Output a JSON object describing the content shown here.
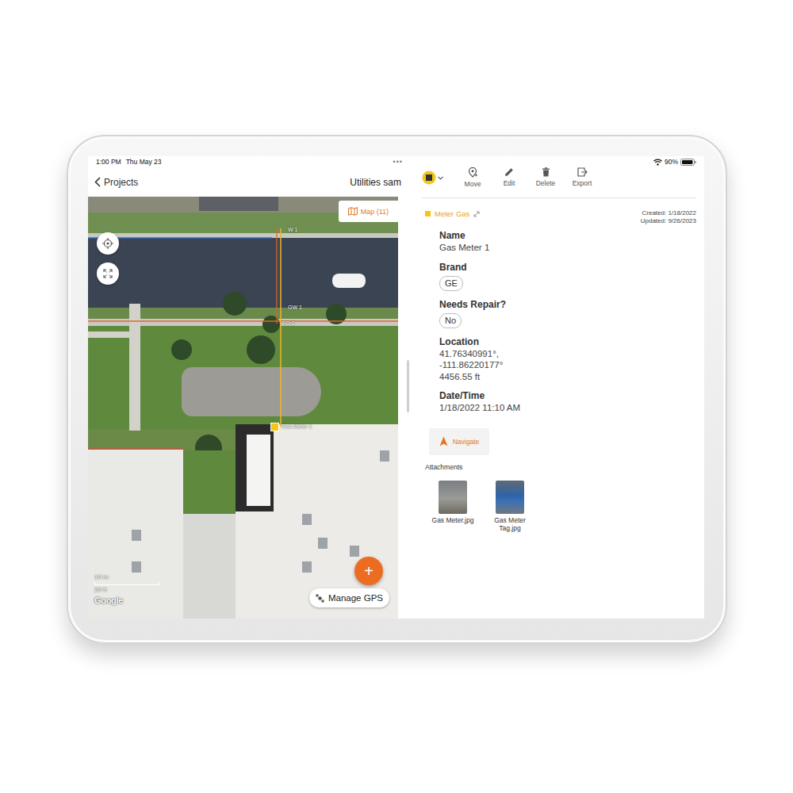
{
  "status_bar": {
    "time": "1:00 PM",
    "date": "Thu May 23",
    "more": "•••",
    "battery": "90%"
  },
  "map_pane": {
    "back": "Projects",
    "title": "Utilities sam",
    "map_button": "Map (11)",
    "line_labels": [
      {
        "text": "W 1"
      },
      {
        "text": "GW 1"
      },
      {
        "text": "FO 1"
      }
    ],
    "marker": {
      "label": "Gas Meter 1",
      "color": "#f5c518",
      "selected": true
    },
    "scale": {
      "metric": "10 m",
      "imperial": "20 ft"
    },
    "attribution": "Google",
    "manage_gps": "Manage GPS",
    "add": "+"
  },
  "toolbar": {
    "actions": [
      {
        "label": "Move"
      },
      {
        "label": "Edit"
      },
      {
        "label": "Delete"
      },
      {
        "label": "Export"
      }
    ]
  },
  "record": {
    "layer": "Meter Gas",
    "layer_color": "#f5c518",
    "created": "Created: 1/18/2022",
    "updated": "Updated: 9/26/2023",
    "fields": [
      {
        "label": "Name",
        "kind": "text",
        "values": [
          "Gas Meter 1"
        ]
      },
      {
        "label": "Brand",
        "kind": "chip",
        "values": [
          "GE"
        ]
      },
      {
        "label": "Needs Repair?",
        "kind": "chip",
        "values": [
          "No"
        ]
      },
      {
        "label": "Location",
        "kind": "text",
        "values": [
          "41.76340991°,",
          "-111.86220177°",
          "4456.55 ft"
        ]
      },
      {
        "label": "Date/Time",
        "kind": "text",
        "values": [
          "1/18/2022 11:10 AM"
        ]
      }
    ],
    "navigate": "Navigate"
  },
  "attachments": {
    "title": "Attachments",
    "items": [
      {
        "name": "Gas Meter.jpg"
      },
      {
        "name": "Gas Meter Tag.jpg"
      }
    ]
  }
}
